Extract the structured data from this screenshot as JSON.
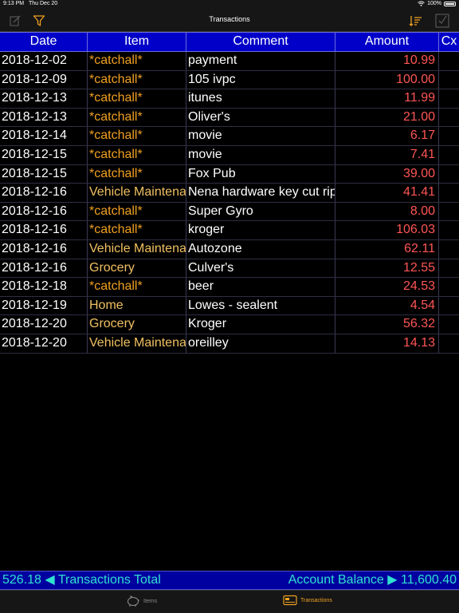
{
  "status": {
    "time": "9:13 PM",
    "date": "Thu Dec 20",
    "battery": "100%"
  },
  "nav": {
    "title": "Transactions"
  },
  "table": {
    "headers": [
      "Date",
      "Item",
      "Comment",
      "Amount",
      "Cx"
    ],
    "rows": [
      {
        "date": "2018-12-02",
        "item": "*catchall*",
        "comment": "payment",
        "amount": "10.99"
      },
      {
        "date": "2018-12-09",
        "item": "*catchall*",
        "comment": "105 ivpc",
        "amount": "100.00"
      },
      {
        "date": "2018-12-13",
        "item": "*catchall*",
        "comment": "itunes",
        "amount": "11.99"
      },
      {
        "date": "2018-12-13",
        "item": "*catchall*",
        "comment": "Oliver's",
        "amount": "21.00"
      },
      {
        "date": "2018-12-14",
        "item": "*catchall*",
        "comment": "movie",
        "amount": "6.17"
      },
      {
        "date": "2018-12-15",
        "item": "*catchall*",
        "comment": "movie",
        "amount": "7.41"
      },
      {
        "date": "2018-12-15",
        "item": "*catchall*",
        "comment": "Fox Pub",
        "amount": "39.00"
      },
      {
        "date": "2018-12-16",
        "item": "Vehicle Maintena",
        "comment": "Nena hardware key cut rip",
        "amount": "41.41"
      },
      {
        "date": "2018-12-16",
        "item": "*catchall*",
        "comment": "Super Gyro",
        "amount": "8.00"
      },
      {
        "date": "2018-12-16",
        "item": "*catchall*",
        "comment": "kroger",
        "amount": "106.03"
      },
      {
        "date": "2018-12-16",
        "item": "Vehicle Maintena",
        "comment": "Autozone",
        "amount": "62.11"
      },
      {
        "date": "2018-12-16",
        "item": "Grocery",
        "comment": "Culver's",
        "amount": "12.55"
      },
      {
        "date": "2018-12-18",
        "item": "*catchall*",
        "comment": "beer",
        "amount": "24.53"
      },
      {
        "date": "2018-12-19",
        "item": "Home",
        "comment": "Lowes - sealent",
        "amount": "4.54"
      },
      {
        "date": "2018-12-20",
        "item": "Grocery",
        "comment": "Kroger",
        "amount": "56.32"
      },
      {
        "date": "2018-12-20",
        "item": "Vehicle Maintena",
        "comment": "oreilley",
        "amount": "14.13"
      }
    ]
  },
  "totals": {
    "left": "526.18 ◀ Transactions Total",
    "right": "Account Balance ▶ 11,600.40"
  },
  "tabs": {
    "items": "Items",
    "transactions": "Transactions"
  },
  "icons": {
    "edit": "edit-icon",
    "filter": "filter-icon",
    "sort": "sort-icon",
    "checkbox": "checkbox-icon",
    "items_tab": "piggy-bank-icon",
    "transactions_tab": "card-icon"
  },
  "colors": {
    "header_bg": "#0000c8",
    "totals_bg": "#0000a0",
    "totals_text": "#30e0d0",
    "amount": "#ff5555",
    "catchall": "#f0a020",
    "accent": "#f0a020"
  }
}
